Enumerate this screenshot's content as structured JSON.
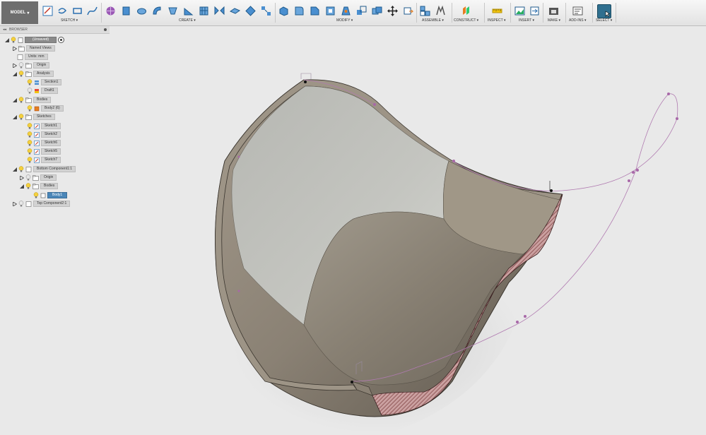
{
  "toolbar": {
    "workspace": "MODEL",
    "groups": [
      {
        "label": "SKETCH"
      },
      {
        "label": "CREATE"
      },
      {
        "label": "MODIFY"
      },
      {
        "label": "ASSEMBLE"
      },
      {
        "label": "CONSTRUCT"
      },
      {
        "label": "INSPECT"
      },
      {
        "label": "INSERT"
      },
      {
        "label": "MAKE"
      },
      {
        "label": "ADD-INS"
      },
      {
        "label": "SELECT"
      }
    ]
  },
  "browser": {
    "title": "BROWSER",
    "items": [
      {
        "label": "(Unsaved)"
      },
      {
        "label": "Named Views"
      },
      {
        "label": "Units: mm"
      },
      {
        "label": "Origin"
      },
      {
        "label": "Analysis"
      },
      {
        "label": "Section1"
      },
      {
        "label": "Draft1"
      },
      {
        "label": "Bodies"
      },
      {
        "label": "Body2 (6)"
      },
      {
        "label": "Sketches"
      },
      {
        "label": "Sketch1"
      },
      {
        "label": "Sketch2"
      },
      {
        "label": "Sketch6"
      },
      {
        "label": "Sketch5"
      },
      {
        "label": "Sketch7"
      },
      {
        "label": "Bottom Component1:1"
      },
      {
        "label": "Origin"
      },
      {
        "label": "Bodies"
      },
      {
        "label": "Body1"
      },
      {
        "label": "Top Component2:1"
      }
    ]
  },
  "colors": {
    "toolbar_bg": "#eeeeee",
    "viewport_bg": "#e9e9e9",
    "selection_blue": "#4a86b8",
    "sketch_curve": "#b07ab0",
    "section_hatch": "#7a3c3c"
  }
}
